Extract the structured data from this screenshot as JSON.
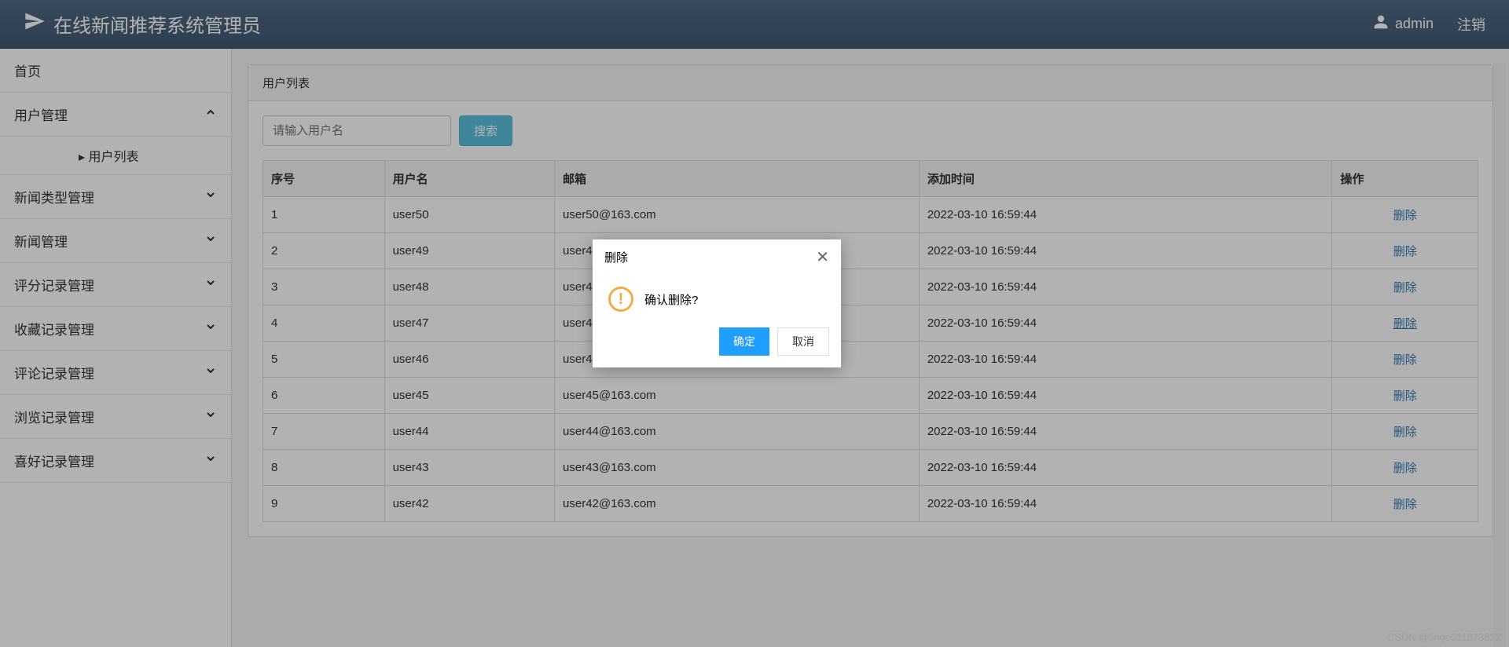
{
  "header": {
    "title": "在线新闻推荐系统管理员",
    "username": "admin",
    "logout": "注销"
  },
  "sidebar": {
    "items": [
      {
        "label": "首页",
        "hasChildren": false
      },
      {
        "label": "用户管理",
        "hasChildren": true,
        "expanded": true,
        "children": [
          {
            "label": "用户列表"
          }
        ]
      },
      {
        "label": "新闻类型管理",
        "hasChildren": true
      },
      {
        "label": "新闻管理",
        "hasChildren": true
      },
      {
        "label": "评分记录管理",
        "hasChildren": true
      },
      {
        "label": "收藏记录管理",
        "hasChildren": true
      },
      {
        "label": "评论记录管理",
        "hasChildren": true
      },
      {
        "label": "浏览记录管理",
        "hasChildren": true
      },
      {
        "label": "喜好记录管理",
        "hasChildren": true
      }
    ]
  },
  "panel": {
    "title": "用户列表",
    "search_placeholder": "请输入用户名",
    "search_button": "搜索",
    "columns": [
      "序号",
      "用户名",
      "邮箱",
      "添加时间",
      "操作"
    ],
    "action_label": "删除",
    "rows": [
      {
        "id": "1",
        "username": "user50",
        "email": "user50@163.com",
        "time": "2022-03-10 16:59:44"
      },
      {
        "id": "2",
        "username": "user49",
        "email": "user49@163.com",
        "time": "2022-03-10 16:59:44"
      },
      {
        "id": "3",
        "username": "user48",
        "email": "user48@163.com",
        "time": "2022-03-10 16:59:44"
      },
      {
        "id": "4",
        "username": "user47",
        "email": "user47@163.com",
        "time": "2022-03-10 16:59:44"
      },
      {
        "id": "5",
        "username": "user46",
        "email": "user46@163.com",
        "time": "2022-03-10 16:59:44"
      },
      {
        "id": "6",
        "username": "user45",
        "email": "user45@163.com",
        "time": "2022-03-10 16:59:44"
      },
      {
        "id": "7",
        "username": "user44",
        "email": "user44@163.com",
        "time": "2022-03-10 16:59:44"
      },
      {
        "id": "8",
        "username": "user43",
        "email": "user43@163.com",
        "time": "2022-03-10 16:59:44"
      },
      {
        "id": "9",
        "username": "user42",
        "email": "user42@163.com",
        "time": "2022-03-10 16:59:44"
      }
    ]
  },
  "dialog": {
    "title": "删除",
    "message": "确认删除?",
    "ok": "确定",
    "cancel": "取消"
  },
  "watermark": "CSDN @linge511873822"
}
